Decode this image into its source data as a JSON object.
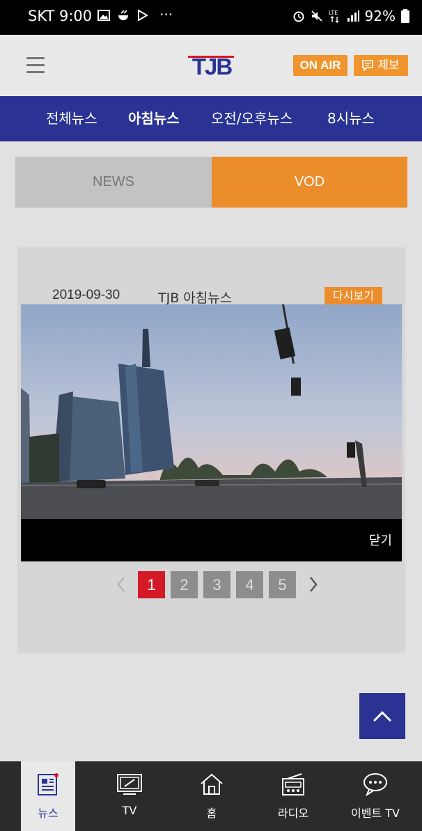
{
  "status_bar": {
    "carrier_time": "SKT 9:00",
    "more": "···",
    "battery": "92%"
  },
  "header": {
    "logo_text": "TJB",
    "on_air_label": "ON AIR",
    "report_label": "제보"
  },
  "nav": {
    "items": [
      "전체뉴스",
      "아침뉴스",
      "오전/오후뉴스",
      "8시뉴스"
    ],
    "active_index": 1
  },
  "tabs": {
    "news_label": "NEWS",
    "vod_label": "VOD",
    "active": "VOD"
  },
  "video_card": {
    "date": "2019-09-30",
    "program": "TJB 아침뉴스",
    "replay_label": "다시보기",
    "close_label": "닫기"
  },
  "pagination": {
    "pages": [
      "1",
      "2",
      "3",
      "4",
      "5"
    ],
    "current": "1"
  },
  "bottom_nav": {
    "items": [
      "뉴스",
      "TV",
      "홈",
      "라디오",
      "이벤트 TV"
    ],
    "active": "뉴스"
  },
  "colors": {
    "brand_blue": "#2a3393",
    "accent_orange": "#ec8d2b",
    "active_page_red": "#d31a26"
  }
}
